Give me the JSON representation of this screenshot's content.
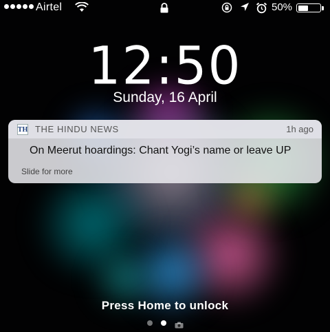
{
  "status_bar": {
    "carrier": "Airtel",
    "battery_text": "50%",
    "battery_level": 0.5,
    "icons": [
      "signal-dots",
      "wifi-icon",
      "lock-icon",
      "rotation-lock-icon",
      "location-icon",
      "alarm-icon",
      "battery-icon"
    ]
  },
  "lock_screen": {
    "time": "12:50",
    "date": "Sunday, 16 April",
    "unlock_hint": "Press Home to unlock",
    "pages": [
      "page-dot",
      "page-dot-active",
      "camera-page"
    ]
  },
  "notification": {
    "app_icon_text": "TH",
    "app_name": "THE HINDU NEWS",
    "time": "1h ago",
    "title": "On Meerut hoardings: Chant Yogi’s name or leave UP",
    "subtitle": "Slide for more"
  }
}
